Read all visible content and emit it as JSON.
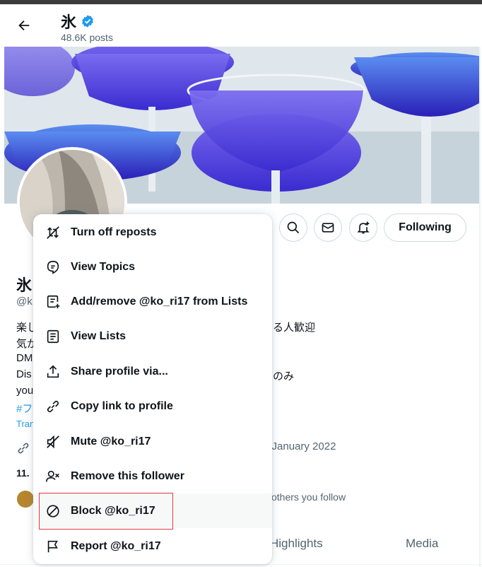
{
  "header": {
    "name": "氷",
    "posts": "48.6K posts"
  },
  "actions": {
    "follow_label": "Following"
  },
  "profile": {
    "name": "氷",
    "handle": "@k",
    "bio_lines": [
      "楽し",
      "気が",
      "DM",
      "Dis",
      "you"
    ],
    "bio_right": [
      "る人歓迎",
      "のみ"
    ],
    "hashtag": "#フ",
    "translate": "Tran",
    "joined": "d January 2022",
    "following_count": "11.",
    "followed_by": "others you follow"
  },
  "tabs": [
    "Highlights",
    "Media"
  ],
  "menu": {
    "items": [
      {
        "label": "Turn off reposts",
        "icon": "repost-off-icon"
      },
      {
        "label": "View Topics",
        "icon": "topics-icon"
      },
      {
        "label": "Add/remove @ko_ri17 from Lists",
        "icon": "list-add-icon"
      },
      {
        "label": "View Lists",
        "icon": "lists-icon"
      },
      {
        "label": "Share profile via...",
        "icon": "share-icon"
      },
      {
        "label": "Copy link to profile",
        "icon": "link-icon"
      },
      {
        "label": "Mute @ko_ri17",
        "icon": "mute-icon"
      },
      {
        "label": "Remove this follower",
        "icon": "remove-follower-icon"
      },
      {
        "label": "Block @ko_ri17",
        "icon": "block-icon"
      },
      {
        "label": "Report @ko_ri17",
        "icon": "flag-icon"
      }
    ]
  },
  "colors": {
    "accent": "#1d9bf0",
    "highlight": "#e0383e",
    "text": "#0f1419",
    "muted": "#536471"
  }
}
